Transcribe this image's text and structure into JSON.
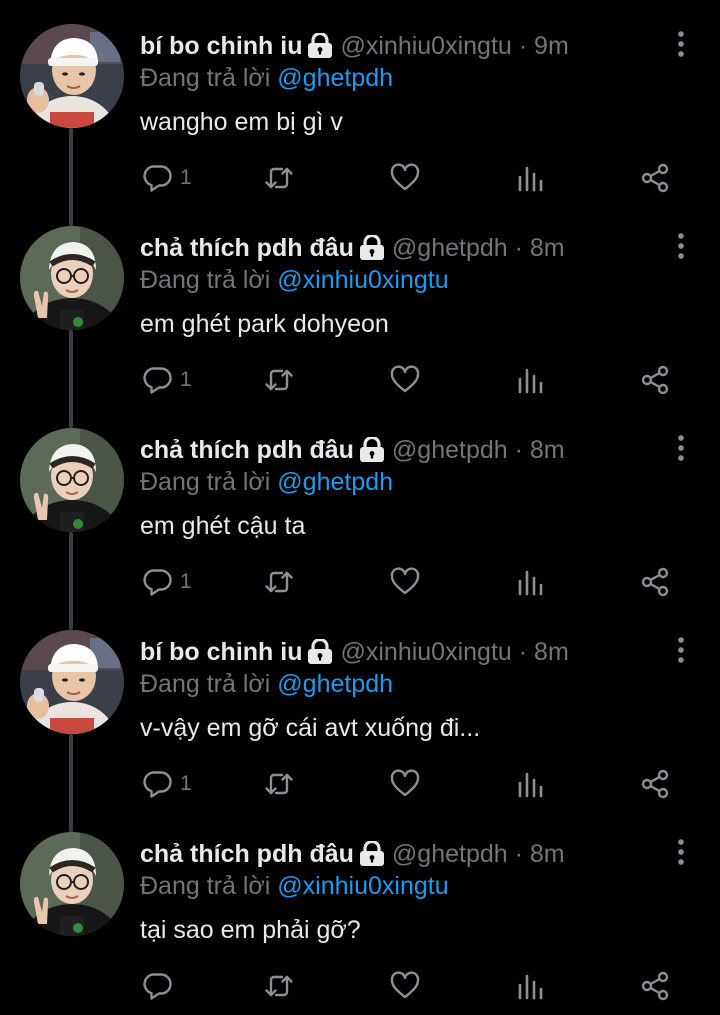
{
  "tweets": [
    {
      "display_name": "bí bo chinh iu",
      "handle": "@xinhiu0xingtu",
      "dot": "·",
      "time": "9m",
      "reply_prefix": "Đang trả lời",
      "reply_to": "@ghetpdh",
      "text": "wangho em bị gì v",
      "reply_count": "1",
      "avatar": "avatar-boy-beanie"
    },
    {
      "display_name": "chả thích pdh đâu",
      "handle": "@ghetpdh",
      "dot": "·",
      "time": "8m",
      "reply_prefix": "Đang trả lời",
      "reply_to": "@xinhiu0xingtu",
      "text": "em ghét park dohyeon",
      "reply_count": "1",
      "avatar": "avatar-boy-glasses"
    },
    {
      "display_name": "chả thích pdh đâu",
      "handle": "@ghetpdh",
      "dot": "·",
      "time": "8m",
      "reply_prefix": "Đang trả lời",
      "reply_to": "@ghetpdh",
      "text": "em ghét cậu ta",
      "reply_count": "1",
      "avatar": "avatar-boy-glasses"
    },
    {
      "display_name": "bí bo chinh iu",
      "handle": "@xinhiu0xingtu",
      "dot": "·",
      "time": "8m",
      "reply_prefix": "Đang trả lời",
      "reply_to": "@ghetpdh",
      "text": "v-vậy em gỡ cái avt xuống đi...",
      "reply_count": "1",
      "avatar": "avatar-boy-beanie"
    },
    {
      "display_name": "chả thích pdh đâu",
      "handle": "@ghetpdh",
      "dot": "·",
      "time": "8m",
      "reply_prefix": "Đang trả lời",
      "reply_to": "@xinhiu0xingtu",
      "text": "tại sao em phải gỡ?",
      "reply_count": "",
      "avatar": "avatar-boy-glasses"
    }
  ],
  "icons": {
    "lock": "lock-icon",
    "more": "more-vertical-icon",
    "reply": "reply-icon",
    "retweet": "retweet-icon",
    "like": "heart-icon",
    "stats": "stats-icon",
    "share": "share-icon"
  },
  "colors": {
    "background": "#000000",
    "primary_text": "#e7e9ea",
    "secondary_text": "#71767b",
    "link": "#1d9bf0",
    "thread_line": "#3a3f44"
  }
}
